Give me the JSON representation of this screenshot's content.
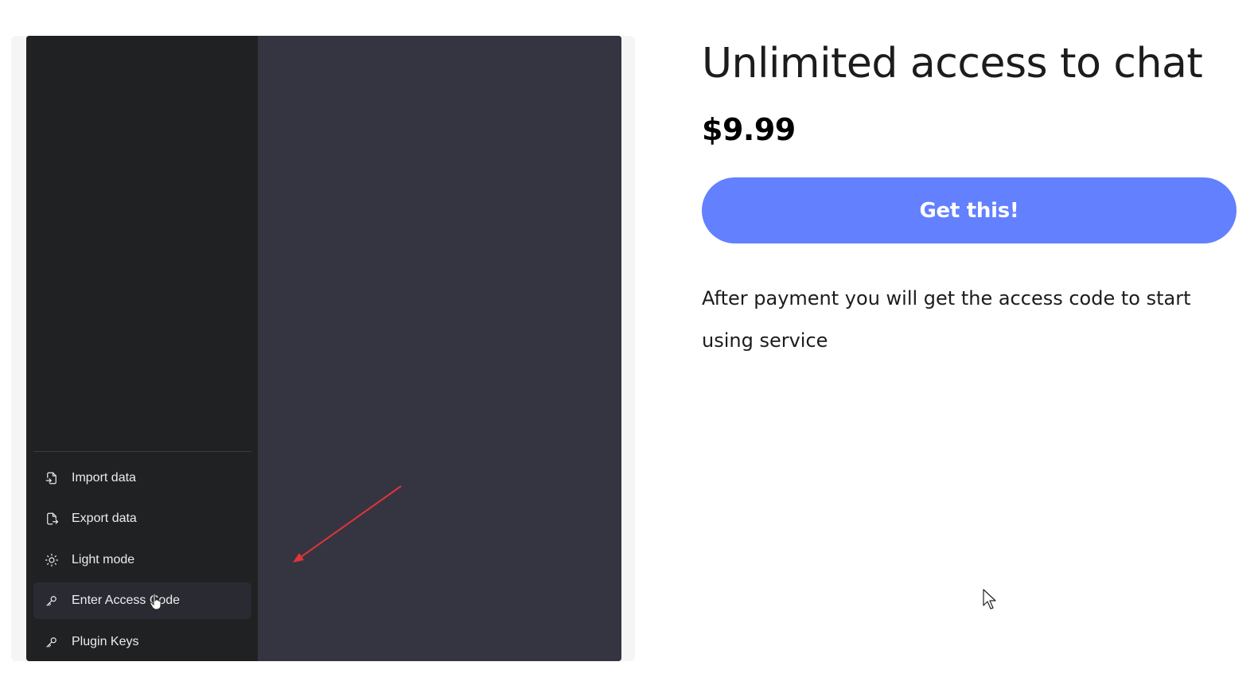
{
  "preview": {
    "sidebar": {
      "items": [
        {
          "label": "Import data",
          "icon": "file-import-icon"
        },
        {
          "label": "Export data",
          "icon": "file-export-icon"
        },
        {
          "label": "Light mode",
          "icon": "sun-icon"
        },
        {
          "label": "Enter Access Code",
          "icon": "key-icon",
          "active": true
        },
        {
          "label": "Plugin Keys",
          "icon": "key-icon"
        }
      ]
    },
    "colors": {
      "sidebar_bg": "#202123",
      "main_bg": "#353541",
      "annotation_arrow": "#e0353a"
    }
  },
  "product": {
    "title": "Unlimited access to chat",
    "price": "$9.99",
    "buy_button_label": "Get this!",
    "description": "After payment you will get the access code to start using service"
  },
  "colors": {
    "accent": "#6380ff",
    "text": "#1c1c1c"
  }
}
